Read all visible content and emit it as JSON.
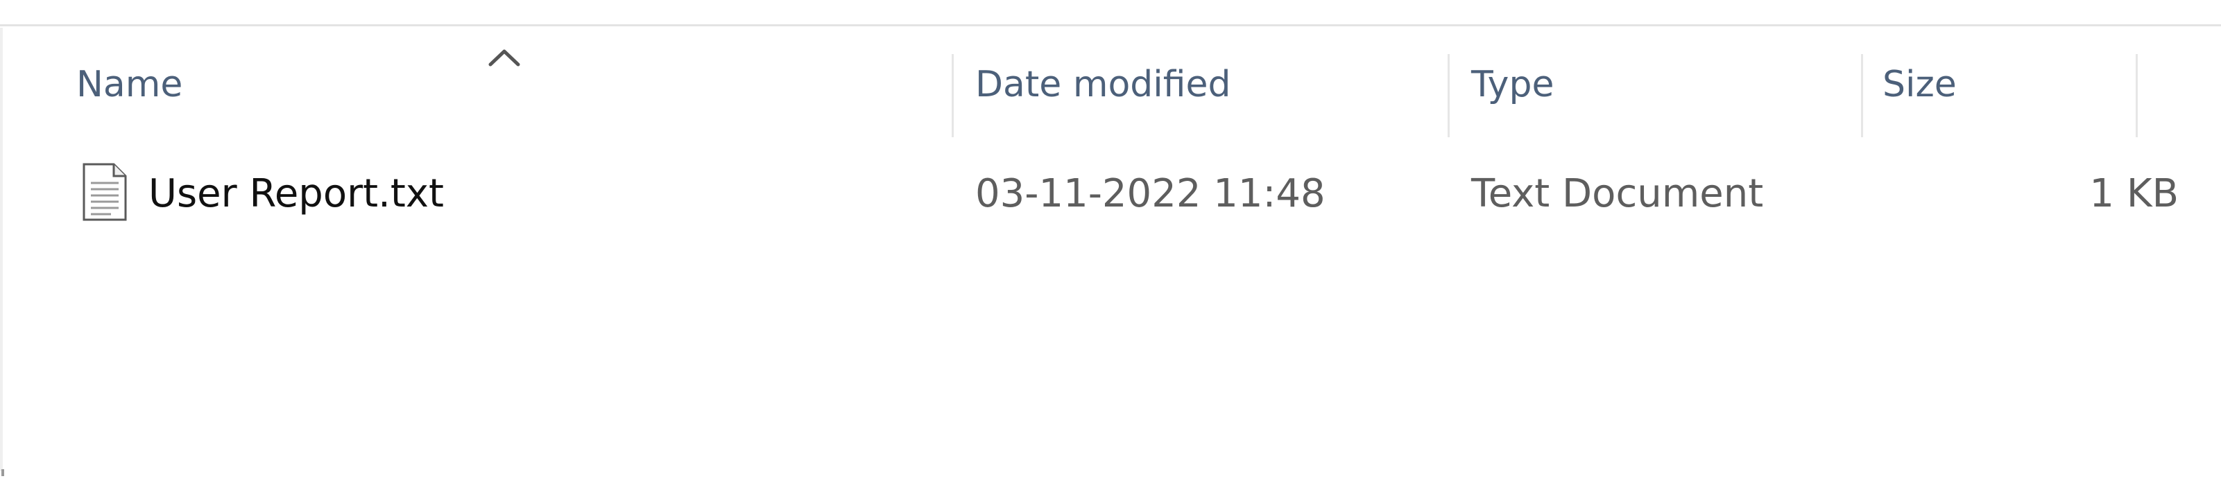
{
  "file_list": {
    "sorted_column": "name",
    "sort_direction": "ascending",
    "sort_icon": "chevron-up-icon",
    "columns": {
      "name": "Name",
      "date_modified": "Date modified",
      "type": "Type",
      "size": "Size"
    },
    "rows": [
      {
        "icon": "text-file-icon",
        "name": "User Report.txt",
        "date_modified": "03-11-2022 11:48",
        "type": "Text Document",
        "size": "1 KB"
      }
    ]
  },
  "colors": {
    "header_text": "#4c607a",
    "row_name_text": "#111111",
    "row_detail_text": "#5e5e5e",
    "divider": "#e6e6e6"
  }
}
